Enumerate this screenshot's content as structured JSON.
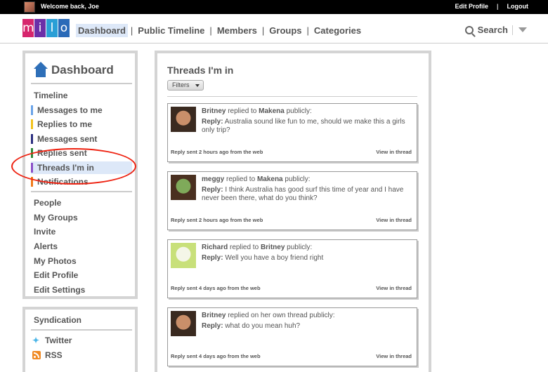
{
  "topbar": {
    "welcome": "Welcome back, Joe",
    "edit_profile": "Edit Profile",
    "separator": "|",
    "logout": "Logout"
  },
  "logo": {
    "letters": [
      "m",
      "i",
      "l",
      "o"
    ],
    "colors": [
      "#d6256c",
      "#6b2fa8",
      "#2a9fd6",
      "#2a6ab8"
    ]
  },
  "nav": {
    "items": [
      "Dashboard",
      "Public Timeline",
      "Members",
      "Groups",
      "Categories"
    ],
    "separator": "|",
    "search_label": "Search"
  },
  "sidebar": {
    "title": "Dashboard",
    "timeline": "Timeline",
    "sub_items": [
      {
        "label": "Messages to me",
        "color": "#6aa3e8"
      },
      {
        "label": "Replies to me",
        "color": "#f2c21b"
      },
      {
        "label": "Messages sent",
        "color": "#2b2f80"
      },
      {
        "label": "Replies sent",
        "color": "#2e8a3a"
      },
      {
        "label": "Threads I'm in",
        "color": "#8a4fc8"
      },
      {
        "label": "Notifications",
        "color": "#f07a1a"
      }
    ],
    "links": [
      "People",
      "My Groups",
      "Invite",
      "Alerts",
      "My Photos",
      "Edit Profile",
      "Edit Settings"
    ]
  },
  "syndication": {
    "title": "Syndication",
    "twitter": "Twitter",
    "rss": "RSS"
  },
  "main": {
    "title": "Threads I'm in",
    "filters_label": "Filters",
    "threads": [
      {
        "author": "Britney",
        "action": " replied to ",
        "target": "Makena",
        "suffix": " publicly:",
        "reply_label": "Reply:",
        "reply_text": " Australia sound like fun to me, should we make this a girls only trip?",
        "meta": "Reply sent 2 hours ago from the web",
        "view": "View in thread",
        "avatar_colors": [
          "#3a2a20",
          "#c98f6a"
        ]
      },
      {
        "author": "meggy",
        "action": " replied to ",
        "target": "Makena",
        "suffix": " publicly:",
        "reply_label": "Reply:",
        "reply_text": " I think Australia has good surf this time of year and I have never been there, what do you think?",
        "meta": "Reply sent 2 hours ago from the web",
        "view": "View in thread",
        "avatar_colors": [
          "#4a3020",
          "#7faa5a"
        ]
      },
      {
        "author": "Richard",
        "action": " replied to ",
        "target": "Britney",
        "suffix": " publicly:",
        "reply_label": "Reply:",
        "reply_text": " Well you have a boy friend right",
        "meta": "Reply sent 4 days ago from the web",
        "view": "View in thread",
        "avatar_colors": [
          "#c8e07a",
          "#f4f6e8"
        ]
      },
      {
        "author": "Britney",
        "action": " replied on her own thread publicly:",
        "target": "",
        "suffix": "",
        "reply_label": "Reply:",
        "reply_text": " what do you mean huh?",
        "meta": "Reply sent 4 days ago from the web",
        "view": "View in thread",
        "avatar_colors": [
          "#3a2a20",
          "#c98f6a"
        ]
      }
    ]
  }
}
